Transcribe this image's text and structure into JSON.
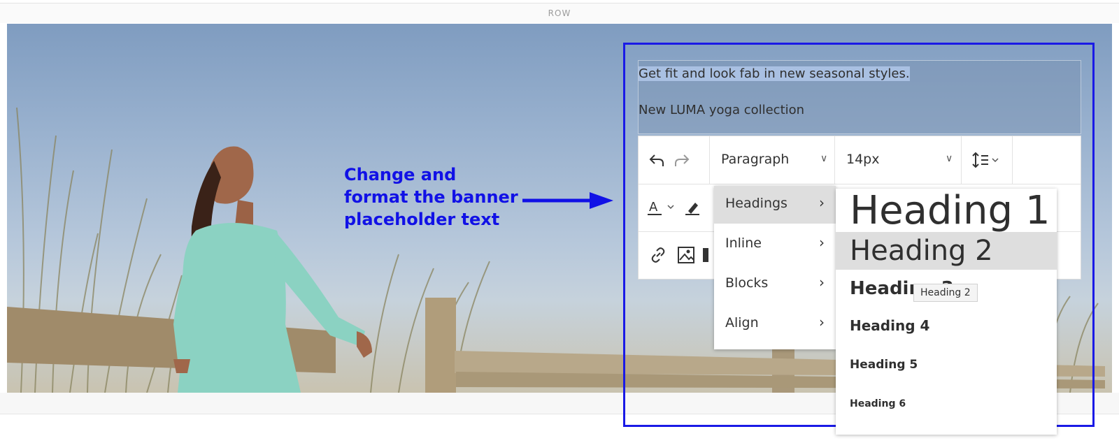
{
  "row": {
    "label": "ROW"
  },
  "banner": {
    "line1": "Get fit and look fab in new seasonal styles.",
    "line2": "New LUMA yoga collection"
  },
  "annotation": {
    "line1": "Change and",
    "line2": "format the banner",
    "line3": "placeholder text",
    "color": "#1111e6"
  },
  "toolbar": {
    "format_select": "Paragraph",
    "size_select": "14px"
  },
  "menu": {
    "items": [
      {
        "label": "Headings",
        "active": true
      },
      {
        "label": "Inline"
      },
      {
        "label": "Blocks"
      },
      {
        "label": "Align"
      }
    ]
  },
  "submenu": {
    "items": [
      {
        "label": "Heading 1"
      },
      {
        "label": "Heading 2",
        "active": true
      },
      {
        "label": "Heading 3"
      },
      {
        "label": "Heading 4"
      },
      {
        "label": "Heading 5"
      },
      {
        "label": "Heading 6"
      }
    ]
  },
  "tooltip": {
    "text": "Heading 2"
  },
  "icons": {
    "undo": "undo-icon",
    "redo": "redo-icon",
    "line_height": "line-height-icon",
    "text_color": "text-color-icon",
    "highlight": "highlight-icon",
    "link": "link-icon",
    "image": "image-icon"
  }
}
